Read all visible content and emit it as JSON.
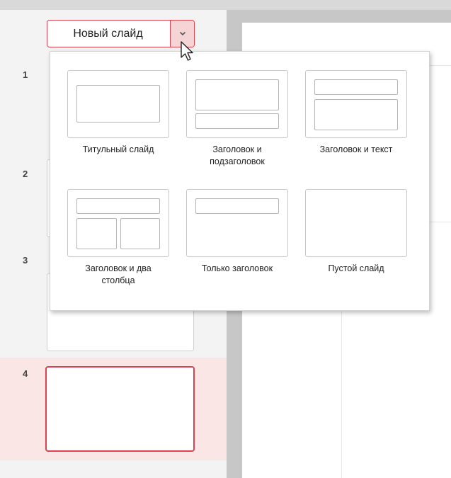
{
  "new_slide_button": {
    "label": "Новый слайд"
  },
  "slides": [
    {
      "number": "1"
    },
    {
      "number": "2"
    },
    {
      "number": "3"
    },
    {
      "number": "4"
    }
  ],
  "layouts": [
    {
      "label": "Титульный слайд"
    },
    {
      "label": "Заголовок и подзаголовок"
    },
    {
      "label": "Заголовок и текст"
    },
    {
      "label": "Заголовок и два столбца"
    },
    {
      "label": "Только заголовок"
    },
    {
      "label": "Пустой слайд"
    }
  ],
  "colors": {
    "accent": "#d9424e",
    "accent_light": "#f6d3d5",
    "selected_row": "#fbe6e6"
  },
  "icons": {
    "dropdown": "chevron-down-icon",
    "cursor": "mouse-pointer-icon"
  }
}
